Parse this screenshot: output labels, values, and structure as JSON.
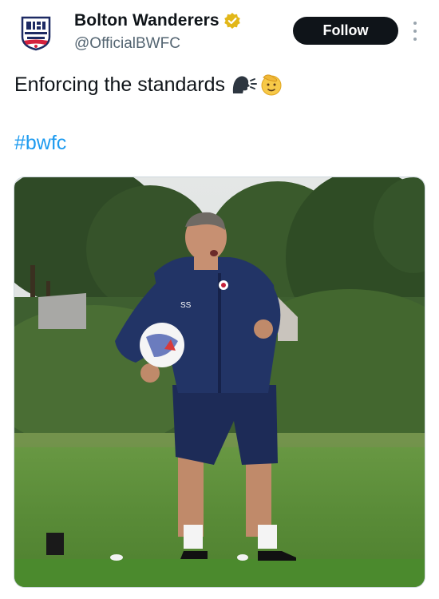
{
  "tweet": {
    "display_name": "Bolton Wanderers",
    "handle": "@OfficialBWFC",
    "follow_label": "Follow",
    "text": "Enforcing the standards",
    "hashtag": "#bwfc",
    "verified": true,
    "badge_color": "#e2b719",
    "link_color": "#1d9bf0"
  },
  "icons": {
    "avatar": "bolton-crest-icon",
    "verified": "verified-badge-icon",
    "more": "more-options-icon",
    "emoji_1": "speaking-head-emoji",
    "emoji_2": "saluting-face-emoji"
  },
  "media": {
    "player_initials": "SS"
  }
}
